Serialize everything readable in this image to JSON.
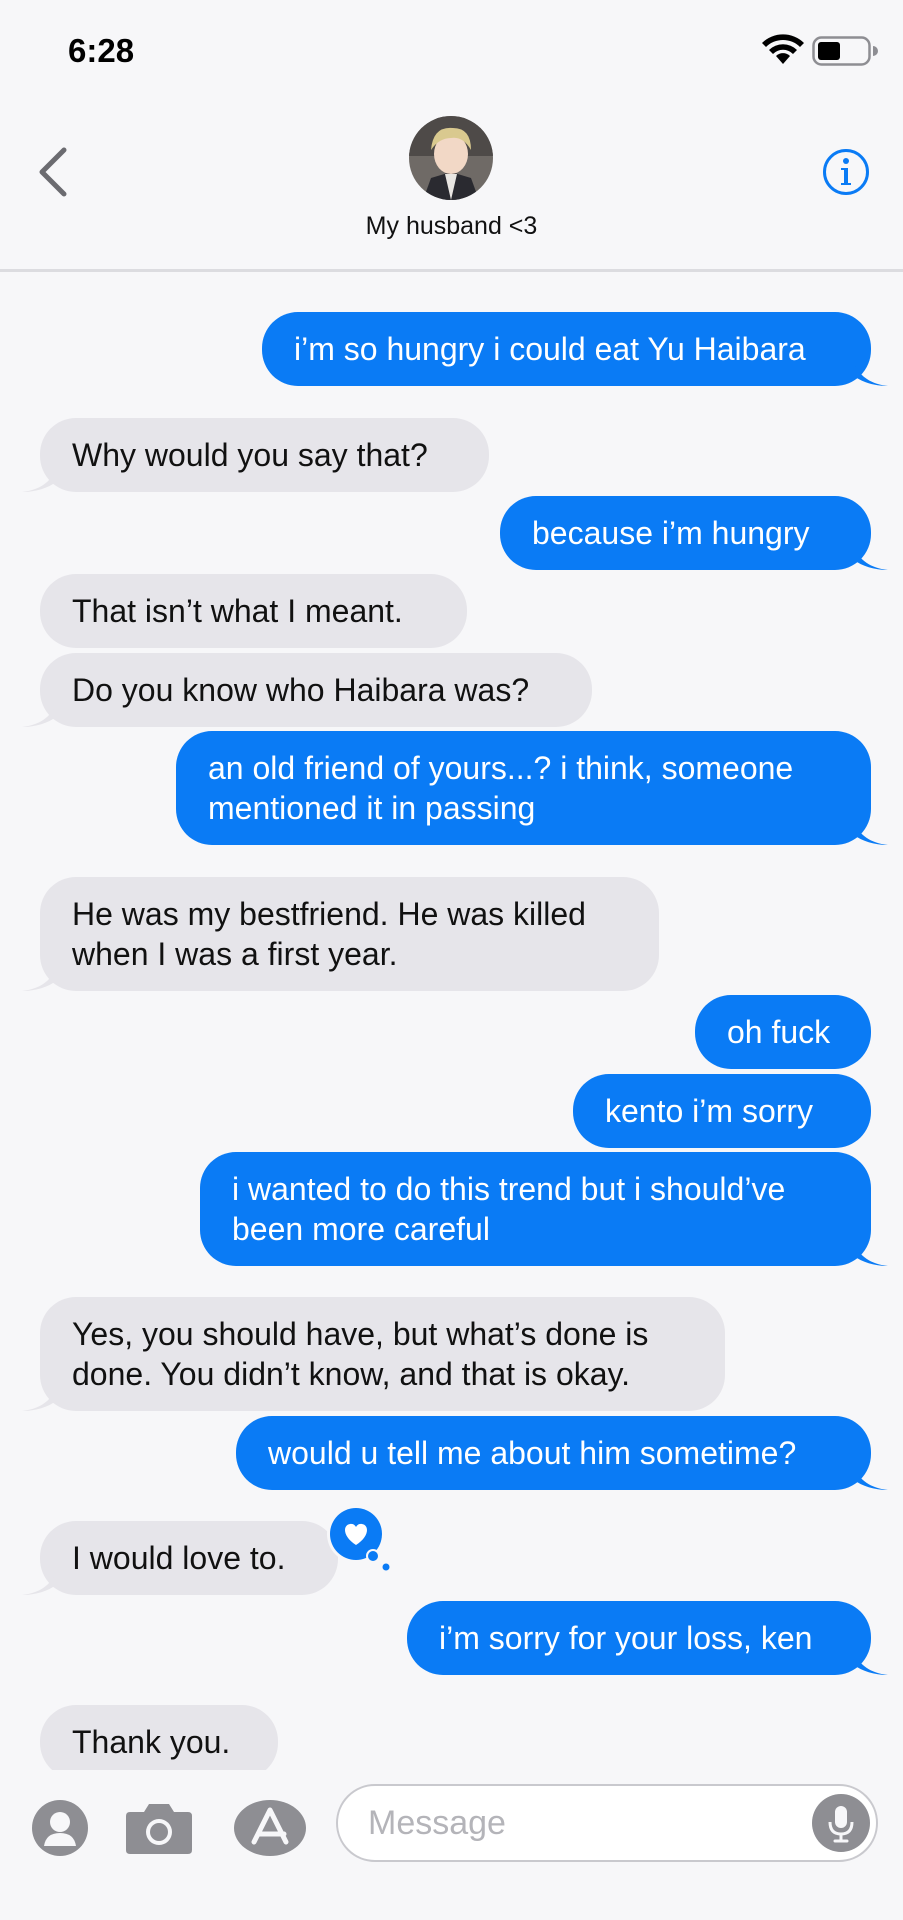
{
  "status": {
    "time": "6:28"
  },
  "header": {
    "contact_name": "My husband <3"
  },
  "messages": [
    {
      "from": "me",
      "text": "i’m so hungry i could eat Yu Haibara"
    },
    {
      "from": "them",
      "text": "Why would you say that?"
    },
    {
      "from": "me",
      "text": "because i’m hungry"
    },
    {
      "from": "them",
      "text": "That isn’t what I meant."
    },
    {
      "from": "them",
      "text": "Do you know who Haibara was?"
    },
    {
      "from": "me",
      "text": "an old friend of yours...? i think, someone\nmentioned it in passing"
    },
    {
      "from": "them",
      "text": "He was my bestfriend. He was killed\nwhen I was a first year."
    },
    {
      "from": "me",
      "text": "oh fuck"
    },
    {
      "from": "me",
      "text": "kento i’m sorry"
    },
    {
      "from": "me",
      "text": "i wanted to do this trend but i should’ve\nbeen more careful"
    },
    {
      "from": "them",
      "text": "Yes, you should have, but what’s done is\ndone. You didn’t know, and that is okay."
    },
    {
      "from": "me",
      "text": "would u tell me about him sometime?"
    },
    {
      "from": "them",
      "text": "I would love to.",
      "tapback": "heart"
    },
    {
      "from": "me",
      "text": "i’m sorry for your loss, ken"
    },
    {
      "from": "them",
      "text": "Thank you."
    }
  ],
  "composer": {
    "placeholder": "Message"
  },
  "colors": {
    "sent_bubble": "#0a7bf5",
    "received_bubble": "#e6e5ea",
    "accent": "#0a7bf5"
  }
}
